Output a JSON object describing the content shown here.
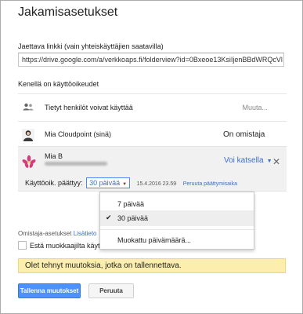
{
  "dialog": {
    "title": "Jakamisasetukset",
    "link_label": "Jaettava linkki (vain yhteiskäyttäjien saatavilla)",
    "link_url": "https://drive.google.com/a/verkkoaps.fi/folderview?id=0Bxeoe13KsiIjenBBdWRQcVl",
    "access_label": "Kenellä on käyttöoikeudet"
  },
  "access_rows": [
    {
      "name": "Tietyt henkilöt voivat käyttää",
      "action": "Muuta..."
    },
    {
      "name": "Mia Cloudpoint (sinä)",
      "role": "On omistaja"
    },
    {
      "name": "Mia B",
      "permission": "Voi katsella",
      "expiry_label": "Käyttöoik. päättyy:",
      "expiry_value": "30 päivää",
      "expiry_date": "15.4.2016 23.59",
      "expiry_cancel": "Peruuta päättymisaika"
    }
  ],
  "expiry_dropdown": {
    "options": [
      "7 päivää",
      "30 päivää",
      "Muokattu päivämäärä..."
    ],
    "selected": "30 päivää"
  },
  "owner_settings": {
    "label": "Omistaja-asetukset",
    "more": "Lisätieto",
    "prevent_editors": "Estä muokkaajilta käyttö"
  },
  "notice": "Olet tehnyt muutoksia, jotka on tallennettava.",
  "buttons": {
    "save": "Tallenna muutokset",
    "cancel": "Peruuta"
  },
  "colors": {
    "primary_button": "#4d90fe",
    "link": "#3b6fc6",
    "notice_bg": "#fcefae"
  }
}
